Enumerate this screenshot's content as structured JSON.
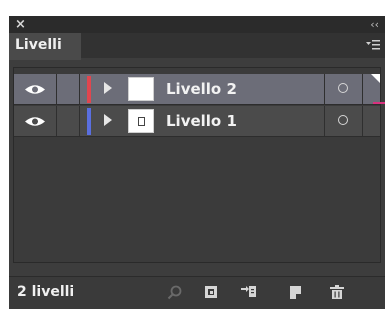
{
  "window": {
    "close_glyph": "×",
    "collapse_glyph": "‹‹"
  },
  "tab": {
    "label": "Livelli"
  },
  "layers": [
    {
      "name": "Livello 2",
      "color": "#e0464f",
      "selected": true
    },
    {
      "name": "Livello 1",
      "color": "#5a6fe0",
      "selected": false
    }
  ],
  "footer": {
    "count_label": "2 livelli"
  },
  "colors": {
    "panel_bg": "#3d3d3d",
    "selected_row": "#6c6d78",
    "selection_indicator": "#d9317e"
  },
  "icons": {
    "panel_menu": "panel-menu-icon",
    "bottom": [
      "locate-object-icon",
      "make-clipping-mask-icon",
      "create-sublayer-icon",
      "create-new-layer-icon",
      "delete-icon"
    ]
  }
}
